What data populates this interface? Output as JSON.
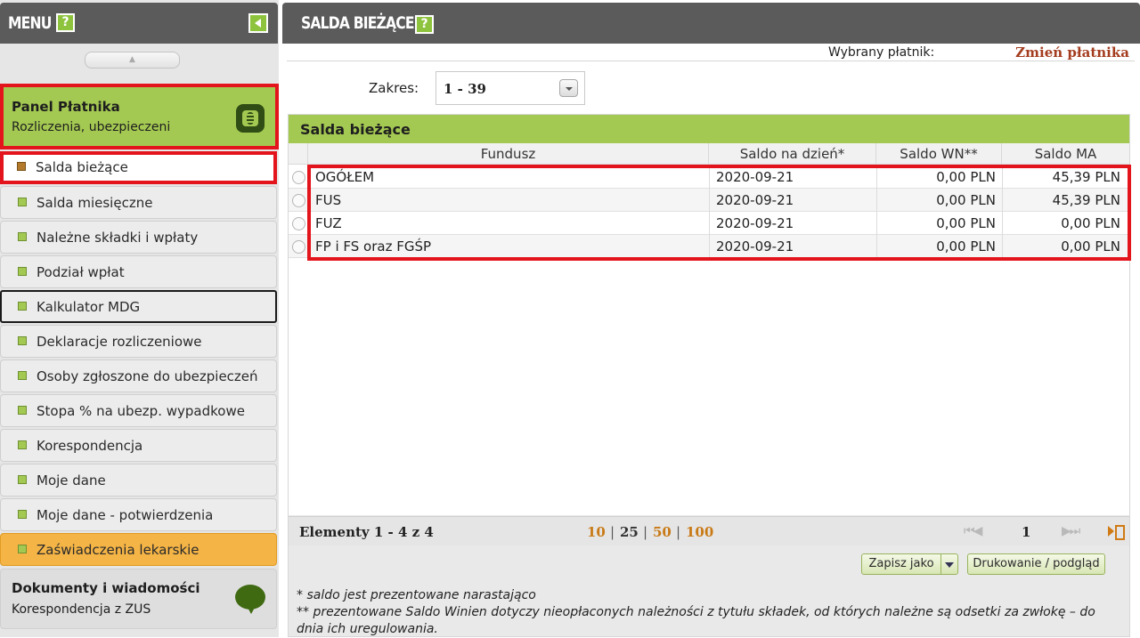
{
  "sidebar": {
    "title": "MENU",
    "help": "?",
    "scroll_up": "▲",
    "panel": {
      "title": "Panel Płatnika",
      "subtitle": "Rozliczenia, ubezpieczeni",
      "icon": "coins-icon"
    },
    "items": [
      {
        "label": "Salda bieżące",
        "state": "active"
      },
      {
        "label": "Salda miesięczne",
        "state": "normal"
      },
      {
        "label": "Należne składki i wpłaty",
        "state": "normal"
      },
      {
        "label": "Podział wpłat",
        "state": "normal"
      },
      {
        "label": "Kalkulator MDG",
        "state": "focused"
      },
      {
        "label": "Deklaracje rozliczeniowe",
        "state": "normal"
      },
      {
        "label": "Osoby zgłoszone do ubezpieczeń",
        "state": "normal"
      },
      {
        "label": "Stopa % na ubezp. wypadkowe",
        "state": "normal"
      },
      {
        "label": "Korespondencja",
        "state": "normal"
      },
      {
        "label": "Moje dane",
        "state": "normal"
      },
      {
        "label": "Moje dane - potwierdzenia",
        "state": "normal"
      },
      {
        "label": "Zaświadczenia lekarskie",
        "state": "highlight"
      }
    ],
    "docs": {
      "title": "Dokumenty i wiadomości",
      "subtitle": "Korespondencja z ZUS",
      "icon": "speech-bubble-icon"
    }
  },
  "main": {
    "title": "SALDA BIEŻĄCE",
    "help": "?",
    "payer_label": "Wybrany płatnik:",
    "payer_change": "Zmień płatnika",
    "range_label": "Zakres:",
    "range_value": "1 - 39",
    "grid": {
      "title": "Salda bieżące",
      "columns": [
        "Fundusz",
        "Saldo na dzień*",
        "Saldo WN**",
        "Saldo MA"
      ],
      "rows": [
        {
          "fund": "OGÓŁEM",
          "date": "2020-09-21",
          "wn": "0,00 PLN",
          "ma": "45,39 PLN"
        },
        {
          "fund": "FUS",
          "date": "2020-09-21",
          "wn": "0,00 PLN",
          "ma": "45,39 PLN"
        },
        {
          "fund": "FUZ",
          "date": "2020-09-21",
          "wn": "0,00 PLN",
          "ma": "0,00 PLN"
        },
        {
          "fund": "FP i FS oraz FGŚP",
          "date": "2020-09-21",
          "wn": "0,00 PLN",
          "ma": "0,00 PLN"
        }
      ],
      "footer": {
        "elements": "Elementy 1 - 4 z 4",
        "page_sizes": [
          "10",
          "25",
          "50",
          "100"
        ],
        "current_page_size": "10",
        "pipe": "|",
        "first_prev": "⏮◀",
        "page": "1",
        "next_last": "▶⏭"
      }
    },
    "buttons": {
      "save": "Zapisz jako",
      "print": "Drukowanie / podgląd"
    },
    "notes": [
      "* saldo jest prezentowane narastająco",
      "** prezentowane Saldo Winien dotyczy nieopłaconych należności z tytułu składek, od których należne są odsetki za zwłokę – do dnia ich uregulowania."
    ]
  },
  "colors": {
    "header": "#5b5b5b",
    "accent_green": "#a4c952",
    "highlight_orange": "#f4b446",
    "link_red": "#a43d1f",
    "outline_red": "#e3141c"
  }
}
